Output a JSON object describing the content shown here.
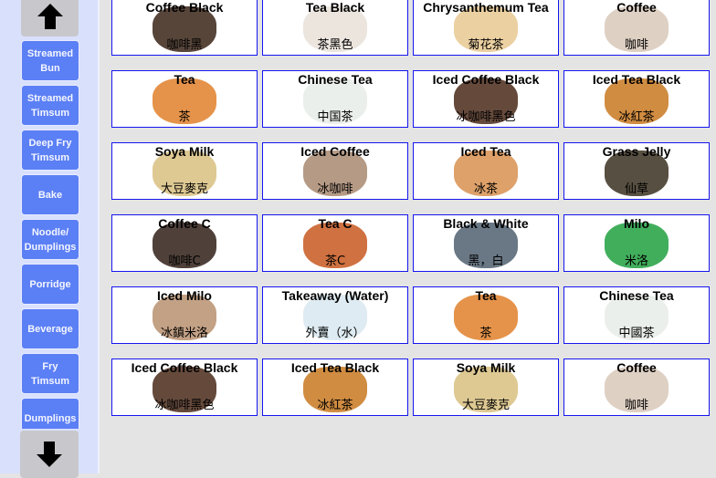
{
  "sidebar": {
    "up_icon": "arrow-up-icon",
    "down_icon": "arrow-down-icon",
    "categories": [
      {
        "label": "Streamed\nBun"
      },
      {
        "label": "Streamed\nTimsum"
      },
      {
        "label": "Deep Fry\nTimsum"
      },
      {
        "label": "Bake"
      },
      {
        "label": "Noodle/\nDumplings"
      },
      {
        "label": "Porridge"
      },
      {
        "label": "Beverage"
      },
      {
        "label": "Fry\nTimsum"
      },
      {
        "label": "Dumplings"
      }
    ],
    "button_color": "#5b7ff5"
  },
  "items": [
    {
      "en": "Coffee Black",
      "zh": "咖啡黑",
      "image": "#3a2418"
    },
    {
      "en": "Tea Black",
      "zh": "茶黑色",
      "image": "#e8e0d8"
    },
    {
      "en": "Chrysanthemum Tea",
      "zh": "菊花茶",
      "image": "#e8c890"
    },
    {
      "en": "Coffee",
      "zh": "咖啡",
      "image": "#d8c8b8"
    },
    {
      "en": "Tea",
      "zh": "茶",
      "image": "#e0802a"
    },
    {
      "en": "Chinese Tea",
      "zh": "中国茶",
      "image": "#e8ece8"
    },
    {
      "en": "Iced Coffee Black",
      "zh": "冰咖啡黑色",
      "image": "#4a2a1a"
    },
    {
      "en": "Iced Tea Black",
      "zh": "冰紅茶",
      "image": "#c87820"
    },
    {
      "en": "Soya Milk",
      "zh": "大豆麥克",
      "image": "#d8c080"
    },
    {
      "en": "Iced Coffee",
      "zh": "冰咖啡",
      "image": "#a88870"
    },
    {
      "en": "Iced Tea",
      "zh": "冰茶",
      "image": "#d89050"
    },
    {
      "en": "Grass Jelly",
      "zh": "仙草",
      "image": "#3a3020"
    },
    {
      "en": "Coffee C",
      "zh": "咖啡C",
      "image": "#302018"
    },
    {
      "en": "Tea C",
      "zh": "茶C",
      "image": "#c85820"
    },
    {
      "en": "Black & White",
      "zh": "黑，白",
      "image": "#506070"
    },
    {
      "en": "Milo",
      "zh": "米洛",
      "image": "#20a040"
    },
    {
      "en": "Iced Milo",
      "zh": "冰鎮米洛",
      "image": "#b89070"
    },
    {
      "en": "Takeaway (Water)",
      "zh": "外賣（水）",
      "image": "#d8e8f0"
    },
    {
      "en": "Tea",
      "zh": "茶",
      "image": "#e0802a"
    },
    {
      "en": "Chinese Tea",
      "zh": "中國茶",
      "image": "#e8ece8"
    },
    {
      "en": "Iced Coffee Black",
      "zh": "冰咖啡黑色",
      "image": "#4a2a1a"
    },
    {
      "en": "Iced Tea Black",
      "zh": "冰紅茶",
      "image": "#c87820"
    },
    {
      "en": "Soya Milk",
      "zh": "大豆麥克",
      "image": "#d8c080"
    },
    {
      "en": "Coffee",
      "zh": "咖啡",
      "image": "#d8c8b8"
    }
  ],
  "card_border_color": "#1515f0"
}
